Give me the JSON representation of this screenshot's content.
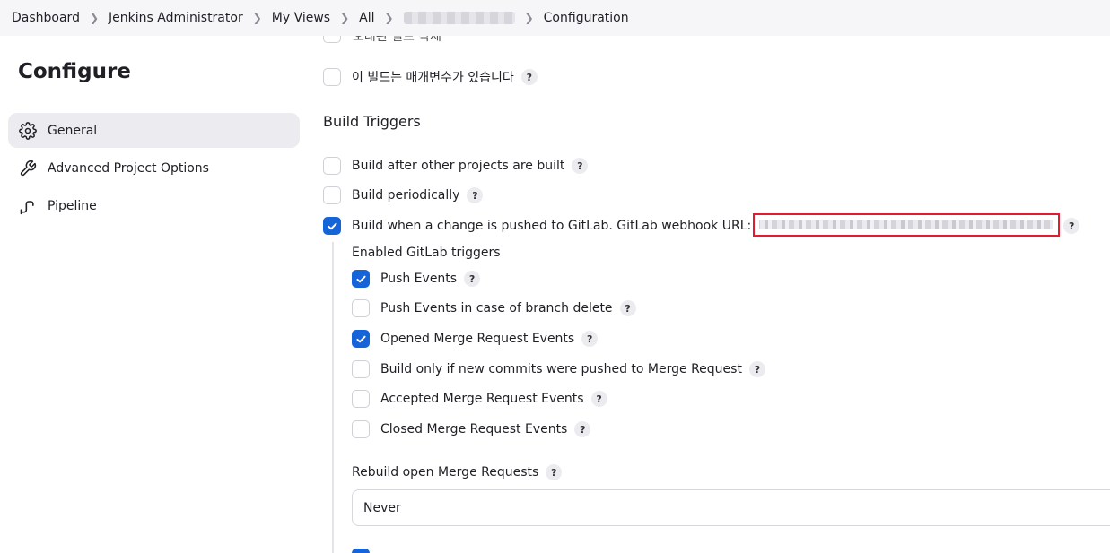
{
  "breadcrumb": {
    "items": [
      "Dashboard",
      "Jenkins Administrator",
      "My Views",
      "All"
    ],
    "current": "Configuration"
  },
  "sidebar": {
    "title": "Configure",
    "items": [
      {
        "label": "General",
        "icon": "gear-icon",
        "active": true
      },
      {
        "label": "Advanced Project Options",
        "icon": "wrench-icon",
        "active": false
      },
      {
        "label": "Pipeline",
        "icon": "pipeline-icon",
        "active": false
      }
    ]
  },
  "main": {
    "clipped_top_text": "오래된 빌드 삭제",
    "parameterized": {
      "label": "이 빌드는 매개변수가 있습니다",
      "checked": false
    },
    "section_title": "Build Triggers",
    "triggers": [
      {
        "label": "Build after other projects are built",
        "checked": false
      },
      {
        "label": "Build periodically",
        "checked": false
      },
      {
        "label": "Build when a change is pushed to GitLab. GitLab webhook URL:",
        "checked": true
      }
    ],
    "gitlab_triggers_label": "Enabled GitLab triggers",
    "gitlab_triggers": [
      {
        "label": "Push Events",
        "checked": true
      },
      {
        "label": "Push Events in case of branch delete",
        "checked": false
      },
      {
        "label": "Opened Merge Request Events",
        "checked": true
      },
      {
        "label": "Build only if new commits were pushed to Merge Request",
        "checked": false
      },
      {
        "label": "Accepted Merge Request Events",
        "checked": false
      },
      {
        "label": "Closed Merge Request Events",
        "checked": false
      }
    ],
    "rebuild_label": "Rebuild open Merge Requests",
    "rebuild_value": "Never",
    "help_glyph": "?"
  },
  "colors": {
    "accent": "#1565d8",
    "highlight": "#e31b2f",
    "sidebar_active": "#ececf0"
  }
}
